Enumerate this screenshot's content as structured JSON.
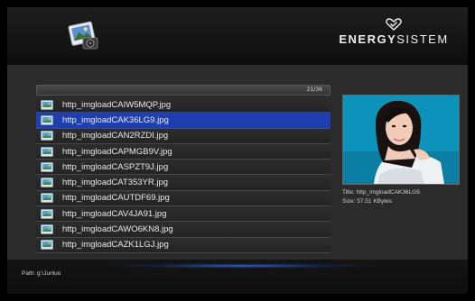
{
  "header": {
    "app_icon": "photo-viewer-icon",
    "brand_bold": "ENERGY",
    "brand_light": "SISTEM",
    "brand_mark": "heart-check-icon"
  },
  "file_list": {
    "counter": "21/36",
    "selected_index": 1,
    "file_icon": "image-file-icon",
    "items": [
      "http_imgloadCAIW5MQP.jpg",
      "http_imgloadCAK36LG9.jpg",
      "http_imgloadCAN2RZDI.jpg",
      "http_imgloadCAPMGB9V.jpg",
      "http_imgloadCASPZT9J.jpg",
      "http_imgloadCAT353YR.jpg",
      "http_imgloadCAUTDF69.jpg",
      "http_imgloadCAV4JA91.jpg",
      "http_imgloadCAWO6KN8.jpg",
      "http_imgloadCAZK1LGJ.jpg"
    ]
  },
  "preview": {
    "title": "Title: http_imgloadCAK36LG9.",
    "size": "Size: 57.51 KBytes"
  },
  "footer": {
    "path": "Path: g:\\Junluo"
  },
  "colors": {
    "selected_row": "#1e3fb0",
    "background": "#2b2b2b",
    "preview_bg": "#0c8fb6"
  }
}
